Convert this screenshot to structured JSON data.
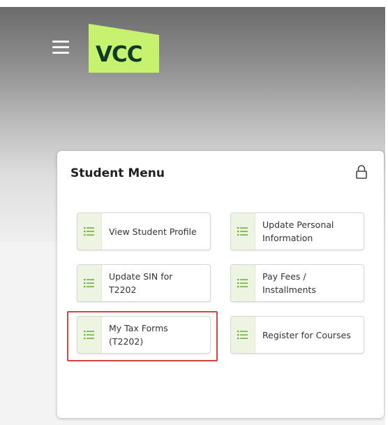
{
  "header": {
    "logo_text": "VCC",
    "brand_color": "#c6f26f",
    "logo_text_color": "#0f3b24",
    "menu_icon": "hamburger-menu-icon"
  },
  "student_menu": {
    "title": "Student Menu",
    "lock_icon": "lock-icon",
    "item_icon": "list-icon",
    "item_icon_color": "#6fb23b",
    "items": [
      {
        "label": "View Student Profile"
      },
      {
        "label": "Update Personal\nInformation"
      },
      {
        "label": "Update SIN for\nT2202"
      },
      {
        "label": "Pay Fees /\nInstallments"
      },
      {
        "label": "My Tax Forms\n(T2202)"
      },
      {
        "label": "Register for Courses"
      }
    ],
    "highlighted_item": "My Tax Forms\n(T2202)",
    "highlight_color": "#d9433f"
  }
}
